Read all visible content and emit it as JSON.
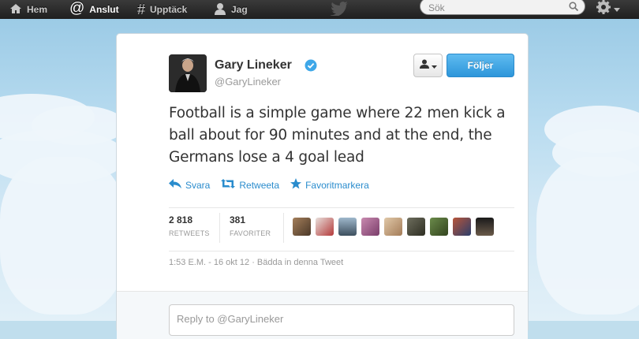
{
  "nav": {
    "items": [
      {
        "label": "Hem",
        "icon": "home-icon"
      },
      {
        "label": "Anslut",
        "icon": "at-icon"
      },
      {
        "label": "Upptäck",
        "icon": "hash-icon"
      },
      {
        "label": "Jag",
        "icon": "person-icon"
      }
    ],
    "search_placeholder": "Sök"
  },
  "tweet": {
    "author_name": "Gary Lineker",
    "screen_name": "@GaryLineker",
    "follow_label": "Följer",
    "text": "Football is a simple game where 22 men kick a ball about for 90 minutes and at the end, the Germans lose a 4 goal lead",
    "actions": {
      "reply": "Svara",
      "retweet": "Retweeta",
      "favorite": "Favoritmarkera"
    },
    "stats": {
      "retweets_count": "2 818",
      "retweets_label": "RETWEETS",
      "favorites_count": "381",
      "favorites_label": "FAVORITER"
    },
    "meta": {
      "time": "1:53 E.M. - 16 okt 12",
      "separator": "·",
      "embed": "Bädda in denna Tweet"
    },
    "reply_placeholder": "Reply to @GaryLineker"
  },
  "colors": {
    "link": "#2a8ccd",
    "follow_button": "#2d96da",
    "verified": "#3ea7e8",
    "topbar": "#2a2a2a"
  }
}
